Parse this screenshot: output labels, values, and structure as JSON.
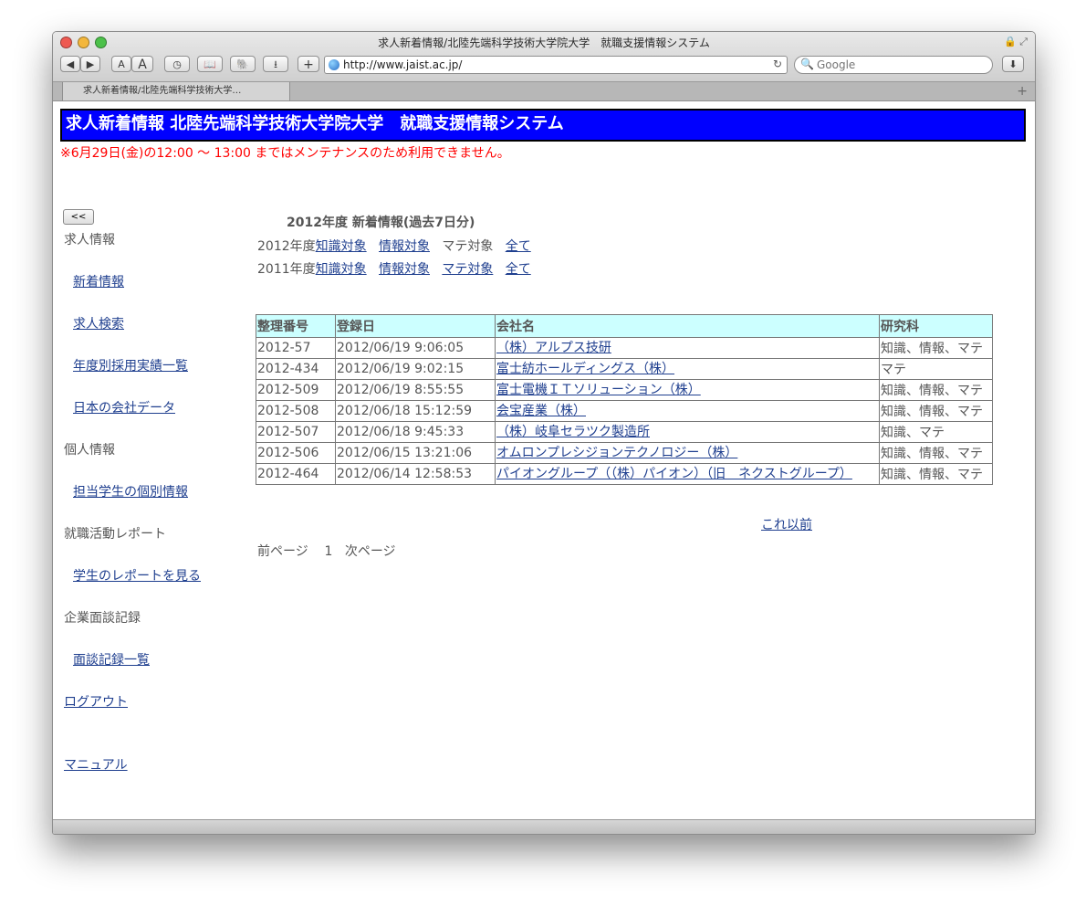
{
  "window": {
    "title": "求人新着情報/北陸先端科学技術大学院大学　就職支援情報システム",
    "url": "http://www.jaist.ac.jp/",
    "search_placeholder": "Google",
    "tab_label": "求人新着情報/北陸先端科学技術大学…",
    "toolbar": {
      "back": "◀",
      "forward": "▶",
      "font_small": "A",
      "font_large": "A",
      "history": "◷",
      "reader": "📖",
      "evernote": "🐘",
      "bookmark": "⭳",
      "add": "+",
      "reload": "↻",
      "search_icon": "🔍",
      "download": "⬇"
    }
  },
  "page": {
    "banner": "求人新着情報 北陸先端科学技術大学院大学　就職支援情報システム",
    "maintenance": "※6月29日(金)の12:00 〜 13:00 まではメンテナンスのため利用できません。",
    "back_button": "<<",
    "sidebar": {
      "cat_jobs": "求人情報",
      "link_new": "新着情報",
      "link_search": "求人検索",
      "link_yearly": "年度別採用実績一覧",
      "link_companies": "日本の会社データ",
      "cat_personal": "個人情報",
      "link_students": "担当学生の個別情報",
      "cat_report": "就職活動レポート",
      "link_reports": "学生のレポートを見る",
      "cat_interview": "企業面談記録",
      "link_interviews": "面談記録一覧",
      "logout": "ログアウト",
      "manual": "マニュアル"
    },
    "heading": "2012年度 新着情報(過去7日分)",
    "filter2012": {
      "year": "2012年度",
      "knowledge": "知識対象",
      "info": "情報対象",
      "material": "マテ対象",
      "all": "全て"
    },
    "filter2011": {
      "year": "2011年度",
      "knowledge": "知識対象",
      "info": "情報対象",
      "material": "マテ対象",
      "all": "全て"
    },
    "table": {
      "headers": [
        "整理番号",
        "登録日",
        "会社名",
        "研究科"
      ],
      "rows": [
        [
          "2012-57",
          "2012/06/19 9:06:05",
          "（株）アルプス技研",
          "知識、情報、マテ"
        ],
        [
          "2012-434",
          "2012/06/19 9:02:15",
          "富士紡ホールディングス（株）",
          "マテ"
        ],
        [
          "2012-509",
          "2012/06/19 8:55:55",
          "富士電機ＩＴソリューション（株）",
          "知識、情報、マテ"
        ],
        [
          "2012-508",
          "2012/06/18 15:12:59",
          "会宝産業（株）",
          "知識、情報、マテ"
        ],
        [
          "2012-507",
          "2012/06/18 9:45:33",
          "（株）岐阜セラツク製造所",
          "知識、マテ"
        ],
        [
          "2012-506",
          "2012/06/15 13:21:06",
          "オムロンプレシジョンテクノロジー（株）",
          "知識、情報、マテ"
        ],
        [
          "2012-464",
          "2012/06/14 12:58:53",
          "パイオングループ（（株）パイオン）（旧　ネクストグループ）",
          "知識、情報、マテ"
        ]
      ]
    },
    "more_link": "これ以前",
    "pager": {
      "prev": "前ページ",
      "page": "1",
      "next": "次ページ"
    }
  }
}
